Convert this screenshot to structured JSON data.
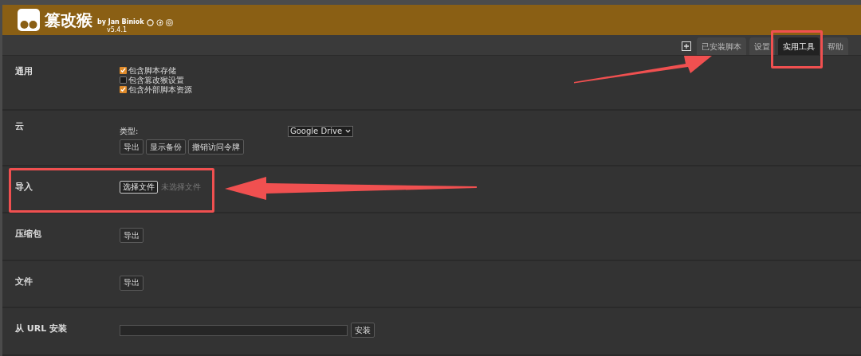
{
  "header": {
    "title": "篡改猴",
    "author": "by Jan Biniok",
    "version": "v5.4.1"
  },
  "tabs": [
    {
      "label": "已安装脚本",
      "selected": false
    },
    {
      "label": "设置",
      "selected": false
    },
    {
      "label": "实用工具",
      "selected": true
    },
    {
      "label": "帮助",
      "selected": false
    }
  ],
  "sections": [
    {
      "kind": "checks",
      "label": "通用",
      "options": [
        {
          "label": "包含脚本存储",
          "checked": true
        },
        {
          "label": "包含篡改猴设置",
          "checked": false
        },
        {
          "label": "包含外部脚本资源",
          "checked": true
        }
      ]
    },
    {
      "kind": "cloud",
      "label": "云",
      "type_label": "类型:",
      "select_value": "Google Drive",
      "buttons": [
        "导出",
        "显示备份",
        "撤销访问令牌"
      ]
    },
    {
      "kind": "file",
      "label": "导入",
      "button": "选择文件",
      "status": "未选择文件"
    },
    {
      "kind": "buttons",
      "label": "压缩包",
      "buttons": [
        "导出"
      ]
    },
    {
      "kind": "buttons",
      "label": "文件",
      "buttons": [
        "导出"
      ]
    },
    {
      "kind": "url",
      "label": "从 URL 安装",
      "button": "安装"
    }
  ]
}
